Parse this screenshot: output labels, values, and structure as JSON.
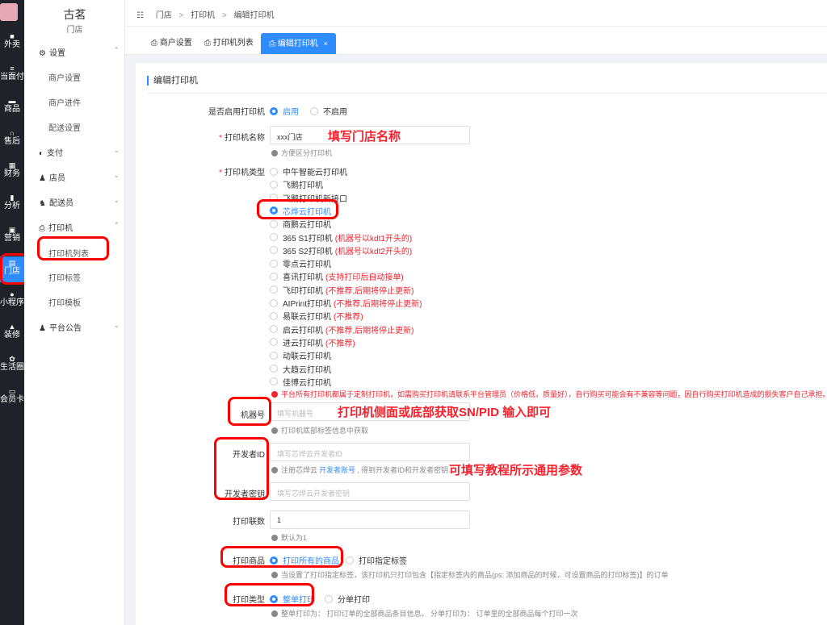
{
  "rail": {
    "items": [
      {
        "label": "外卖",
        "icon": "bag-icon",
        "glyph": "■"
      },
      {
        "label": "当面付",
        "icon": "pay-icon",
        "glyph": "≡"
      },
      {
        "label": "商品",
        "icon": "goods-icon",
        "glyph": "▬"
      },
      {
        "label": "售后",
        "icon": "headset-icon",
        "glyph": "∩"
      },
      {
        "label": "财务",
        "icon": "finance-icon",
        "glyph": "▦"
      },
      {
        "label": "分析",
        "icon": "chart-icon",
        "glyph": "▮"
      },
      {
        "label": "营销",
        "icon": "gift-icon",
        "glyph": "▣"
      },
      {
        "label": "门店",
        "icon": "store-icon",
        "glyph": "▤"
      },
      {
        "label": "小程序",
        "icon": "miniapp-icon",
        "glyph": "●"
      },
      {
        "label": "装修",
        "icon": "decorate-icon",
        "glyph": "▲"
      },
      {
        "label": "生活圈",
        "icon": "circle-icon",
        "glyph": "✿"
      },
      {
        "label": "会员卡",
        "icon": "card-icon",
        "glyph": "▭"
      }
    ]
  },
  "sidebar": {
    "shop_name": "古茗",
    "shop_sub": "门店",
    "groups": [
      {
        "label": "设置",
        "icon": "gear-icon",
        "glyph": "⚙",
        "chev": "⌃"
      },
      {
        "label": "支付",
        "icon": "pay-icon",
        "glyph": "◐",
        "chev": "⌄"
      },
      {
        "label": "店员",
        "icon": "user-icon",
        "glyph": "♟",
        "chev": "⌄"
      },
      {
        "label": "配送员",
        "icon": "courier-icon",
        "glyph": "♞",
        "chev": "⌄"
      },
      {
        "label": "打印机",
        "icon": "printer-icon",
        "glyph": "⎙",
        "chev": "⌃"
      },
      {
        "label": "平台公告",
        "icon": "notice-icon",
        "glyph": "♟",
        "chev": "⌄"
      }
    ],
    "settings_sub": [
      "商户设置",
      "商户进件",
      "配送设置"
    ],
    "printer_sub": [
      "打印机列表",
      "打印标签",
      "打印模板"
    ]
  },
  "breadcrumb": {
    "root_icon": "☷",
    "store": "门店",
    "printer": "打印机",
    "current": "编辑打印机"
  },
  "tabs": [
    {
      "label": "商户设置"
    },
    {
      "label": "打印机列表"
    },
    {
      "label": "编辑打印机",
      "close": "×"
    }
  ],
  "form": {
    "section_title": "编辑打印机",
    "enable_label": "是否启用打印机",
    "enable_on": "启用",
    "enable_off": "不启用",
    "name_label": "打印机名称",
    "name_value": "xxx门店",
    "name_hint": "方便区分打印机",
    "type_label": "打印机类型",
    "types": [
      {
        "name": "中午智能云打印机",
        "note": ""
      },
      {
        "name": "飞鹅打印机",
        "note": ""
      },
      {
        "name": "飞鹅打印机新接口",
        "note": ""
      },
      {
        "name": "芯烨云打印机",
        "note": ""
      },
      {
        "name": "商鹏云打印机",
        "note": ""
      },
      {
        "name": "365 S1打印机",
        "note": "(机器号以kdt1开头的)"
      },
      {
        "name": "365 S2打印机",
        "note": "(机器号以kdt2开头的)"
      },
      {
        "name": "零点云打印机",
        "note": ""
      },
      {
        "name": "喜讯打印机",
        "note": "(支持打印后自动接单)"
      },
      {
        "name": "飞印打印机",
        "note": "(不推荐,后期将停止更新)"
      },
      {
        "name": "AIPrint打印机",
        "note": "(不推荐,后期将停止更新)"
      },
      {
        "name": "易联云打印机",
        "note": "(不推荐)"
      },
      {
        "name": "启云打印机",
        "note": "(不推荐,后期将停止更新)"
      },
      {
        "name": "进云打印机",
        "note": "(不推荐)"
      },
      {
        "name": "动联云打印机",
        "note": ""
      },
      {
        "name": "大趋云打印机",
        "note": ""
      },
      {
        "name": "佳博云打印机",
        "note": ""
      }
    ],
    "type_selected_index": 3,
    "type_warning": "平台所有打印机都属于定制打印机，如需购买打印机请联系平台管理员（价格低，质量好），自行购买可能会有不兼容等问题，因自行购买打印机造成的损失客户自己承担。",
    "sn_label": "机器号",
    "sn_placeholder": "填写机器号",
    "sn_hint": "打印机底部标签信息中获取",
    "dev_id_label": "开发者ID",
    "dev_id_placeholder": "填写芯烨云开发者ID",
    "dev_hint_pre": "注册芯烨云",
    "dev_hint_link": "开发者账号",
    "dev_hint_post": ", 得到开发者ID和开发者密钥.",
    "dev_key_label": "开发者密钥",
    "dev_key_placeholder": "填写芯烨云开发者密钥",
    "copies_label": "打印联数",
    "copies_value": "1",
    "copies_hint": "默认为1",
    "goods_label": "打印商品",
    "goods_all": "打印所有的商品",
    "goods_tag": "打印指定标签",
    "goods_hint": "当设置了打印指定标签，该打印机只打印包含【指定标签内的商品(ps: 添加商品的时候，可设置商品的打印标签)】的订单",
    "print_type_label": "打印类型",
    "print_whole": "整单打印",
    "print_split": "分单打印",
    "print_hint": "整单打印为：  打印订单的全部商品条目信息。  分单打印为：  订单里的全部商品每个打印一次"
  },
  "annotations": {
    "name_note": "填写门店名称",
    "sn_note": "打印机侧面或底部获取SN/PID 输入即可",
    "dev_note": "可填写教程所示通用参数"
  }
}
